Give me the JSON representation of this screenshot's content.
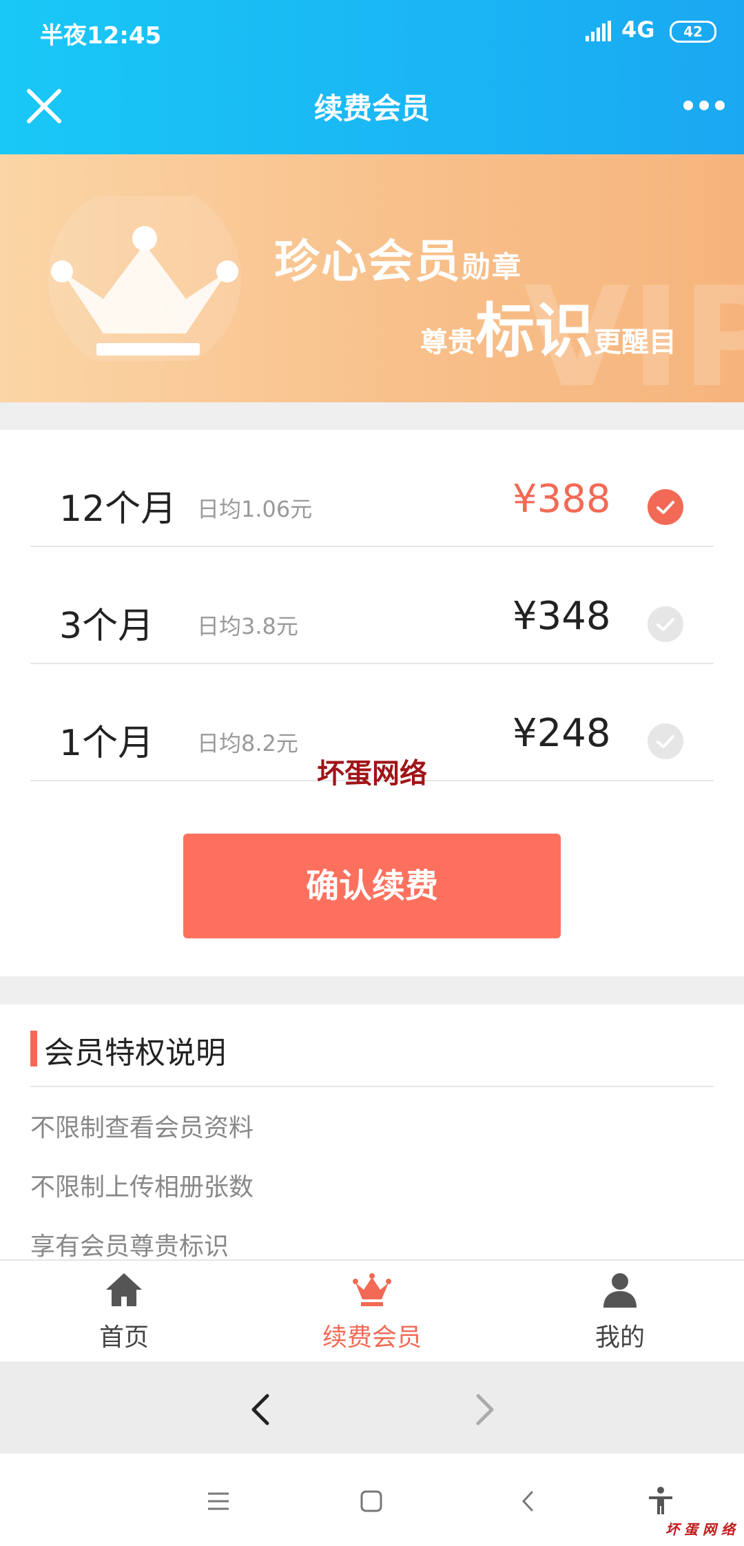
{
  "status_bar": {
    "time": "半夜12:45",
    "network": "4G",
    "battery": "42"
  },
  "title_bar": {
    "title": "续费会员",
    "close_icon": "close-icon",
    "more_icon": "more-icon"
  },
  "banner": {
    "line1_main": "珍心会员",
    "line1_small": "勋章",
    "line2_pre": "尊贵",
    "line2_big": "标识",
    "line2_post": "更醒目",
    "decor_text": "VIP"
  },
  "plans": [
    {
      "duration": "12个月",
      "daily": "日均1.06元",
      "price": "¥388",
      "selected": true
    },
    {
      "duration": "3个月",
      "daily": "日均3.8元",
      "price": "¥348",
      "selected": false
    },
    {
      "duration": "1个月",
      "daily": "日均8.2元",
      "price": "¥248",
      "selected": false
    }
  ],
  "watermark": "坏蛋网络",
  "confirm_label": "确认续费",
  "privileges": {
    "heading": "会员特权说明",
    "items": [
      "不限制查看会员资料",
      "不限制上传相册张数",
      "享有会员尊贵标识"
    ]
  },
  "tabs": [
    {
      "label": "首页",
      "icon": "home-icon",
      "active": false
    },
    {
      "label": "续费会员",
      "icon": "crown-icon",
      "active": true
    },
    {
      "label": "我的",
      "icon": "user-icon",
      "active": false
    }
  ],
  "footer_watermark": "坏 蛋 网 络",
  "colors": {
    "accent": "#f26a55",
    "header": "#1ab4f4",
    "button": "#fe705e"
  }
}
